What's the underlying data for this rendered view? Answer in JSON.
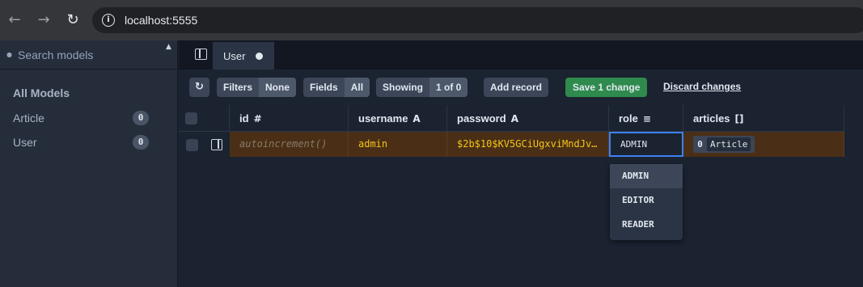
{
  "browser": {
    "url": "localhost:5555",
    "icons": {
      "back": "arrow-left-icon",
      "forward": "arrow-right-icon",
      "reload": "reload-icon",
      "info": "info-icon"
    }
  },
  "sidebar": {
    "search_placeholder": "Search models",
    "heading": "All Models",
    "models": [
      {
        "label": "Article",
        "count": "0"
      },
      {
        "label": "User",
        "count": "0"
      }
    ]
  },
  "tabs": [
    {
      "label": "User",
      "unsaved": true
    }
  ],
  "toolbar": {
    "filters_label": "Filters",
    "filters_value": "None",
    "fields_label": "Fields",
    "fields_value": "All",
    "showing_label": "Showing",
    "showing_value": "1 of 0",
    "add_record": "Add record",
    "save_change": "Save 1 change",
    "discard": "Discard changes"
  },
  "table": {
    "columns": [
      {
        "name": "id",
        "type": "#"
      },
      {
        "name": "username",
        "type": "A"
      },
      {
        "name": "password",
        "type": "A"
      },
      {
        "name": "role",
        "type": "≡"
      },
      {
        "name": "articles",
        "type": "[]"
      }
    ],
    "rows": [
      {
        "id": "autoincrement()",
        "username": "admin",
        "password": "$2b$10$KV5GCiUgxviMndJv…",
        "role": "ADMIN",
        "articles_count": "0",
        "articles_label": "Article"
      }
    ]
  },
  "role_options": [
    "ADMIN",
    "EDITOR",
    "READER"
  ],
  "role_selected": "ADMIN",
  "colors": {
    "save_button": "#2f8a4d",
    "row_highlight": "#4a2f16",
    "cell_text": "#f5c518",
    "focus_border": "#3b82f6"
  }
}
